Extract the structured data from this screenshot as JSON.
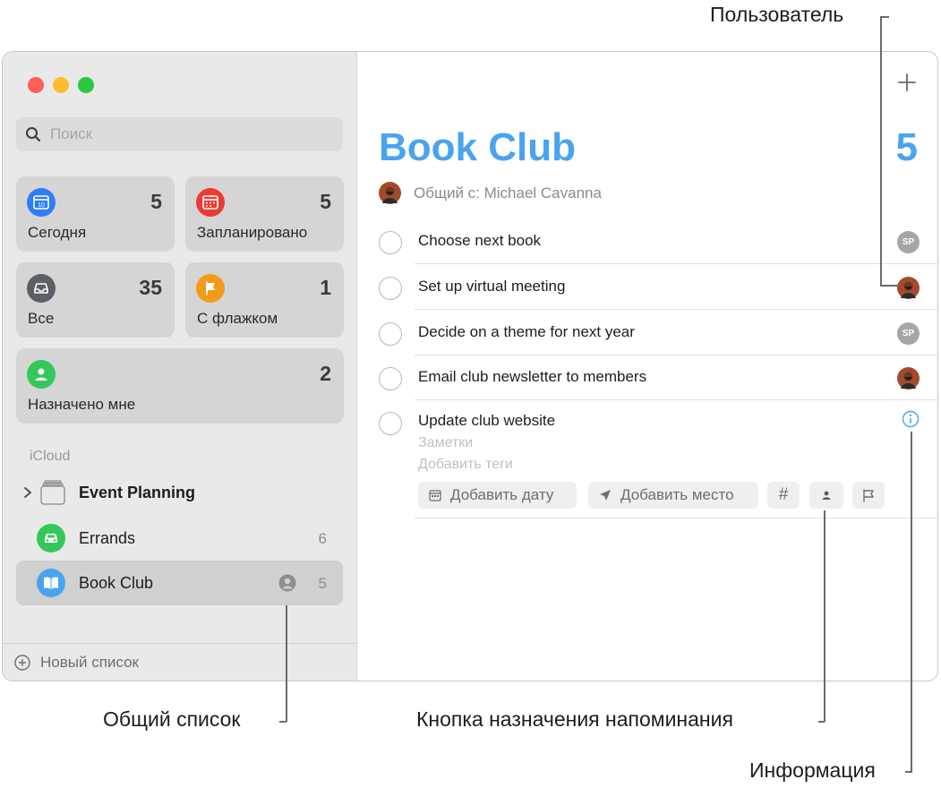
{
  "search": {
    "placeholder": "Поиск"
  },
  "smart_lists": [
    {
      "label": "Сегодня",
      "count": "5",
      "color": "#2f7cf6",
      "icon": "calendar-day-icon",
      "day": "10"
    },
    {
      "label": "Запланировано",
      "count": "5",
      "color": "#ec3b32",
      "icon": "calendar-icon"
    },
    {
      "label": "Все",
      "count": "35",
      "color": "#5b5f66",
      "icon": "tray-icon"
    },
    {
      "label": "С флажком",
      "count": "1",
      "color": "#f59a18",
      "icon": "flag-icon"
    },
    {
      "label": "Назначено мне",
      "count": "2",
      "color": "#34c759",
      "icon": "person-icon"
    }
  ],
  "section_label": "iCloud",
  "lists": [
    {
      "name": "Event Planning",
      "count": "",
      "icon": "folder-group-icon"
    },
    {
      "name": "Errands",
      "count": "6",
      "color": "#34c759",
      "icon": "car-icon"
    },
    {
      "name": "Book Club",
      "count": "5",
      "color": "#4aa3ef",
      "icon": "book-icon",
      "shared": true
    }
  ],
  "new_list_label": "Новый список",
  "main": {
    "title": "Book Club",
    "count": "5",
    "shared_with": "Общий с: Michael Cavanna",
    "accent": "#4aa3ef"
  },
  "tasks": [
    {
      "title": "Choose next book",
      "assignee": "SP"
    },
    {
      "title": "Set up virtual meeting",
      "assignee": "photo"
    },
    {
      "title": "Decide on a theme for next year",
      "assignee": "SP"
    },
    {
      "title": "Email club newsletter to members",
      "assignee": "photo"
    }
  ],
  "editing_task": {
    "title": "Update club website",
    "notes_placeholder": "Заметки",
    "tags_placeholder": "Добавить теги",
    "add_date_label": "Добавить дату",
    "add_location_label": "Добавить место",
    "tag_symbol": "#"
  },
  "callouts": {
    "user": "Пользователь",
    "shared_list": "Общий список",
    "assign_button": "Кнопка назначения напоминания",
    "info": "Информация"
  }
}
